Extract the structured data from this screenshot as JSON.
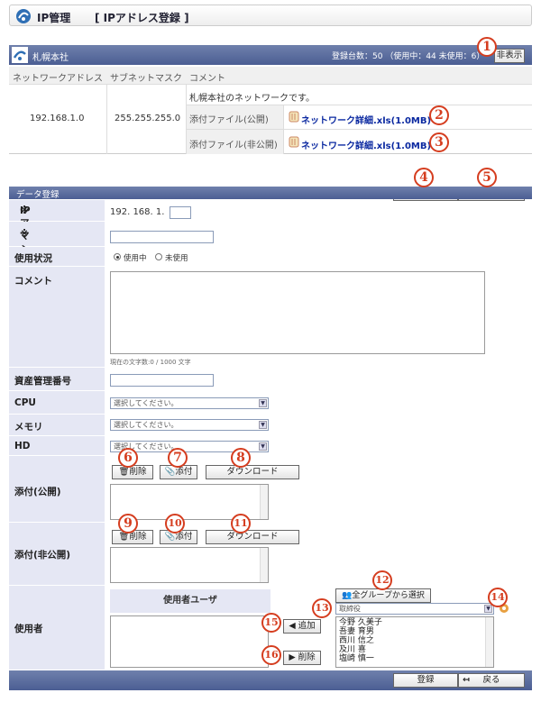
{
  "header": {
    "app_title": "IP管理",
    "page_title": "[ IPアドレス登録 ]"
  },
  "site": {
    "name": "札幌本社",
    "stats": "登録台数：50 （使用中：44 未使用：6）",
    "hide_label": "非表示"
  },
  "ip_table": {
    "columns": [
      "ネットワークアドレス",
      "サブネットマスク",
      "コメント"
    ],
    "network_address": "192.168.1.0",
    "subnet_mask": "255.255.255.0",
    "comment": "札幌本社のネットワークです。",
    "public_attach_label": "添付ファイル(公開)",
    "public_attach_file": "ネットワーク詳細.xls(1.0MB)",
    "private_attach_label": "添付ファイル(非公開)",
    "private_attach_file": "ネットワーク詳細.xls(1.0MB)"
  },
  "form": {
    "section_title": "データ登録",
    "register_label": "登録",
    "back_label": "戻る",
    "ip_label": "IPアドレス",
    "ip_prefix": "192. 168. 1.",
    "required_mark": "※",
    "machine_label": "マシン名",
    "status_label": "使用状況",
    "status_options": [
      "使用中",
      "未使用"
    ],
    "comment_label": "コメント",
    "char_count": "現在の文字数:0 / 1000 文字",
    "asset_label": "資産管理番号",
    "cpu_label": "CPU",
    "memory_label": "メモリ",
    "hd_label": "HD",
    "select_placeholder": "選択してください。",
    "public_attach_label": "添付(公開)",
    "private_attach_label": "添付(非公開)",
    "delete_label": "削除",
    "attach_label": "添付",
    "download_label": "ダウンロード",
    "users_label": "使用者",
    "user_list_header": "使用者ユーザ",
    "group_select_label": "全グループから選択",
    "group_selected": "取締役",
    "add_label": "追加",
    "remove_label": "削除",
    "candidates": [
      "今野 久美子",
      "吾妻 育男",
      "西川 信之",
      "及川 喜",
      "塩崎 慎一"
    ]
  },
  "markers": [
    "1",
    "2",
    "3",
    "4",
    "5",
    "6",
    "7",
    "8",
    "9",
    "10",
    "11",
    "12",
    "13",
    "14",
    "15",
    "16"
  ],
  "colors": {
    "header_blue": "#4b5e93",
    "label_bg": "#e5e7f4",
    "marker_red": "#d53d1f",
    "link_blue": "#0a28a0"
  }
}
